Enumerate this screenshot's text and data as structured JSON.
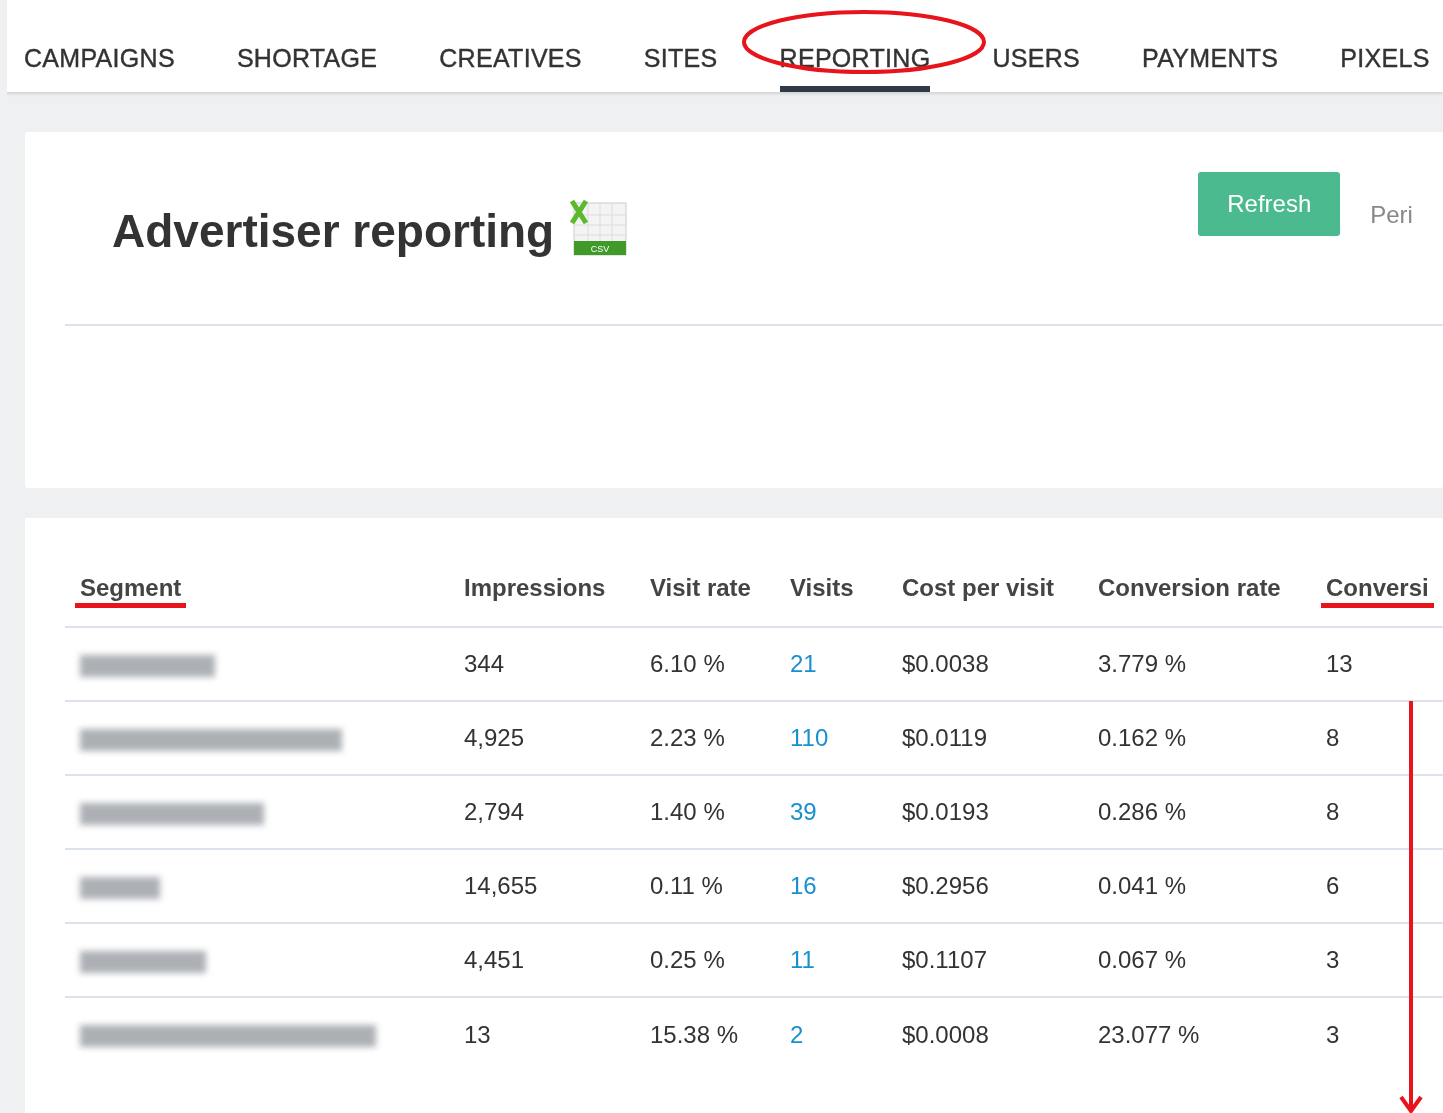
{
  "nav": {
    "tabs": [
      {
        "label": "CAMPAIGNS",
        "selected": false
      },
      {
        "label": "SHORTAGE",
        "selected": false
      },
      {
        "label": "CREATIVES",
        "selected": false
      },
      {
        "label": "SITES",
        "selected": false
      },
      {
        "label": "REPORTING",
        "selected": true,
        "circled": true
      },
      {
        "label": "USERS",
        "selected": false
      },
      {
        "label": "PAYMENTS",
        "selected": false
      },
      {
        "label": "PIXELS",
        "selected": false
      }
    ]
  },
  "header": {
    "title": "Advertiser reporting",
    "csv_icon_label": "CSV",
    "refresh_button": "Refresh",
    "period_label": "Peri"
  },
  "table": {
    "columns": [
      {
        "label": "Segment",
        "underlined": true
      },
      {
        "label": "Impressions",
        "underlined": false
      },
      {
        "label": "Visit rate",
        "underlined": false
      },
      {
        "label": "Visits",
        "underlined": false
      },
      {
        "label": "Cost per visit",
        "underlined": false
      },
      {
        "label": "Conversion rate",
        "underlined": false
      },
      {
        "label": "Conversi",
        "underlined": true
      }
    ],
    "arrow_on_last_column": true,
    "rows": [
      {
        "segment": {
          "kind": "blurred"
        },
        "impressions": "344",
        "visit_rate": "6.10 %",
        "visits": "21",
        "cost_per_visit": "$0.0038",
        "conversion_rate": "3.779 %",
        "conversions": "13"
      },
      {
        "segment": {
          "kind": "blurred"
        },
        "impressions": "4,925",
        "visit_rate": "2.23 %",
        "visits": "110",
        "cost_per_visit": "$0.0119",
        "conversion_rate": "0.162 %",
        "conversions": "8"
      },
      {
        "segment": {
          "kind": "blurred"
        },
        "impressions": "2,794",
        "visit_rate": "1.40 %",
        "visits": "39",
        "cost_per_visit": "$0.0193",
        "conversion_rate": "0.286 %",
        "conversions": "8"
      },
      {
        "segment": {
          "kind": "blurred"
        },
        "impressions": "14,655",
        "visit_rate": "0.11 %",
        "visits": "16",
        "cost_per_visit": "$0.2956",
        "conversion_rate": "0.041 %",
        "conversions": "6"
      },
      {
        "segment": {
          "kind": "blurred"
        },
        "impressions": "4,451",
        "visit_rate": "0.25 %",
        "visits": "11",
        "cost_per_visit": "$0.1107",
        "conversion_rate": "0.067 %",
        "conversions": "3"
      },
      {
        "segment": {
          "kind": "blurred"
        },
        "impressions": "13",
        "visit_rate": "15.38 %",
        "visits": "2",
        "cost_per_visit": "$0.0008",
        "conversion_rate": "23.077 %",
        "conversions": "3"
      }
    ]
  }
}
